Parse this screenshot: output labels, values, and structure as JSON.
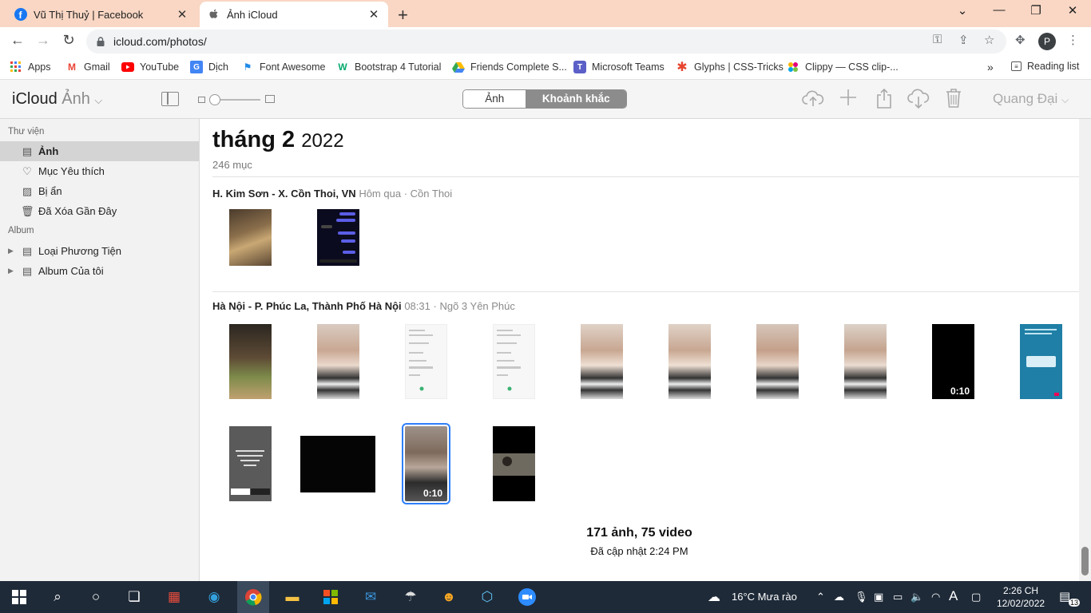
{
  "browser": {
    "tabs": [
      {
        "title": "Vũ Thị Thuỷ | Facebook",
        "icon": "facebook-icon",
        "active": false
      },
      {
        "title": "Ảnh iCloud",
        "icon": "apple-icon",
        "active": true
      }
    ],
    "url": "icloud.com/photos/",
    "profile_initial": "P"
  },
  "bookmarks": [
    {
      "label": "Apps",
      "icon": "apps-grid-icon"
    },
    {
      "label": "Gmail",
      "icon": "gmail-icon"
    },
    {
      "label": "YouTube",
      "icon": "youtube-icon"
    },
    {
      "label": "Dịch",
      "icon": "translate-icon"
    },
    {
      "label": "Font Awesome",
      "icon": "flag-icon"
    },
    {
      "label": "Bootstrap 4 Tutorial",
      "icon": "w3-icon"
    },
    {
      "label": "Friends Complete S...",
      "icon": "drive-icon"
    },
    {
      "label": "Microsoft Teams",
      "icon": "teams-icon"
    },
    {
      "label": "Glyphs | CSS-Tricks",
      "icon": "asterisk-icon"
    },
    {
      "label": "Clippy — CSS clip-...",
      "icon": "clippy-icon"
    }
  ],
  "bookmarks_overflow": "»",
  "reading_list": "Reading list",
  "icloud": {
    "brand": "iCloud",
    "app": "Ảnh",
    "segments": [
      "Ảnh",
      "Khoảnh khắc"
    ],
    "selected_segment": "Khoảnh khắc",
    "user": "Quang Đại"
  },
  "sidebar": {
    "library_header": "Thư viện",
    "library_items": [
      {
        "label": "Ảnh",
        "icon": "photos-icon",
        "selected": true
      },
      {
        "label": "Mục Yêu thích",
        "icon": "heart-icon",
        "selected": false
      },
      {
        "label": "Bị ẩn",
        "icon": "hidden-icon",
        "selected": false
      },
      {
        "label": "Đã Xóa Gần Đây",
        "icon": "trash-icon",
        "selected": false
      }
    ],
    "album_header": "Album",
    "album_items": [
      {
        "label": "Loại Phương Tiện",
        "icon": "folder-icon"
      },
      {
        "label": "Album Của tôi",
        "icon": "folder-icon"
      }
    ]
  },
  "main": {
    "month": "tháng 2",
    "year": "2022",
    "count": "246 mục",
    "moments": [
      {
        "location": "H. Kim Sơn - X. Cồn Thoi, VN",
        "when": "Hôm qua",
        "sep": "·",
        "place": "Cồn Thoi"
      },
      {
        "location": "Hà Nội - P. Phúc La, Thành Phố Hà Nội",
        "when": "08:31",
        "sep": "·",
        "place": "Ngõ 3 Yên Phúc"
      }
    ],
    "durations": {
      "v1": "0:10",
      "v2": "0:10"
    },
    "summary": "171 ảnh, 75 video",
    "updated": "Đã cập nhật 2:24 PM"
  },
  "taskbar": {
    "weather": "16°C  Mưa rào",
    "time": "2:26 CH",
    "date": "12/02/2022",
    "notifications": "13"
  }
}
